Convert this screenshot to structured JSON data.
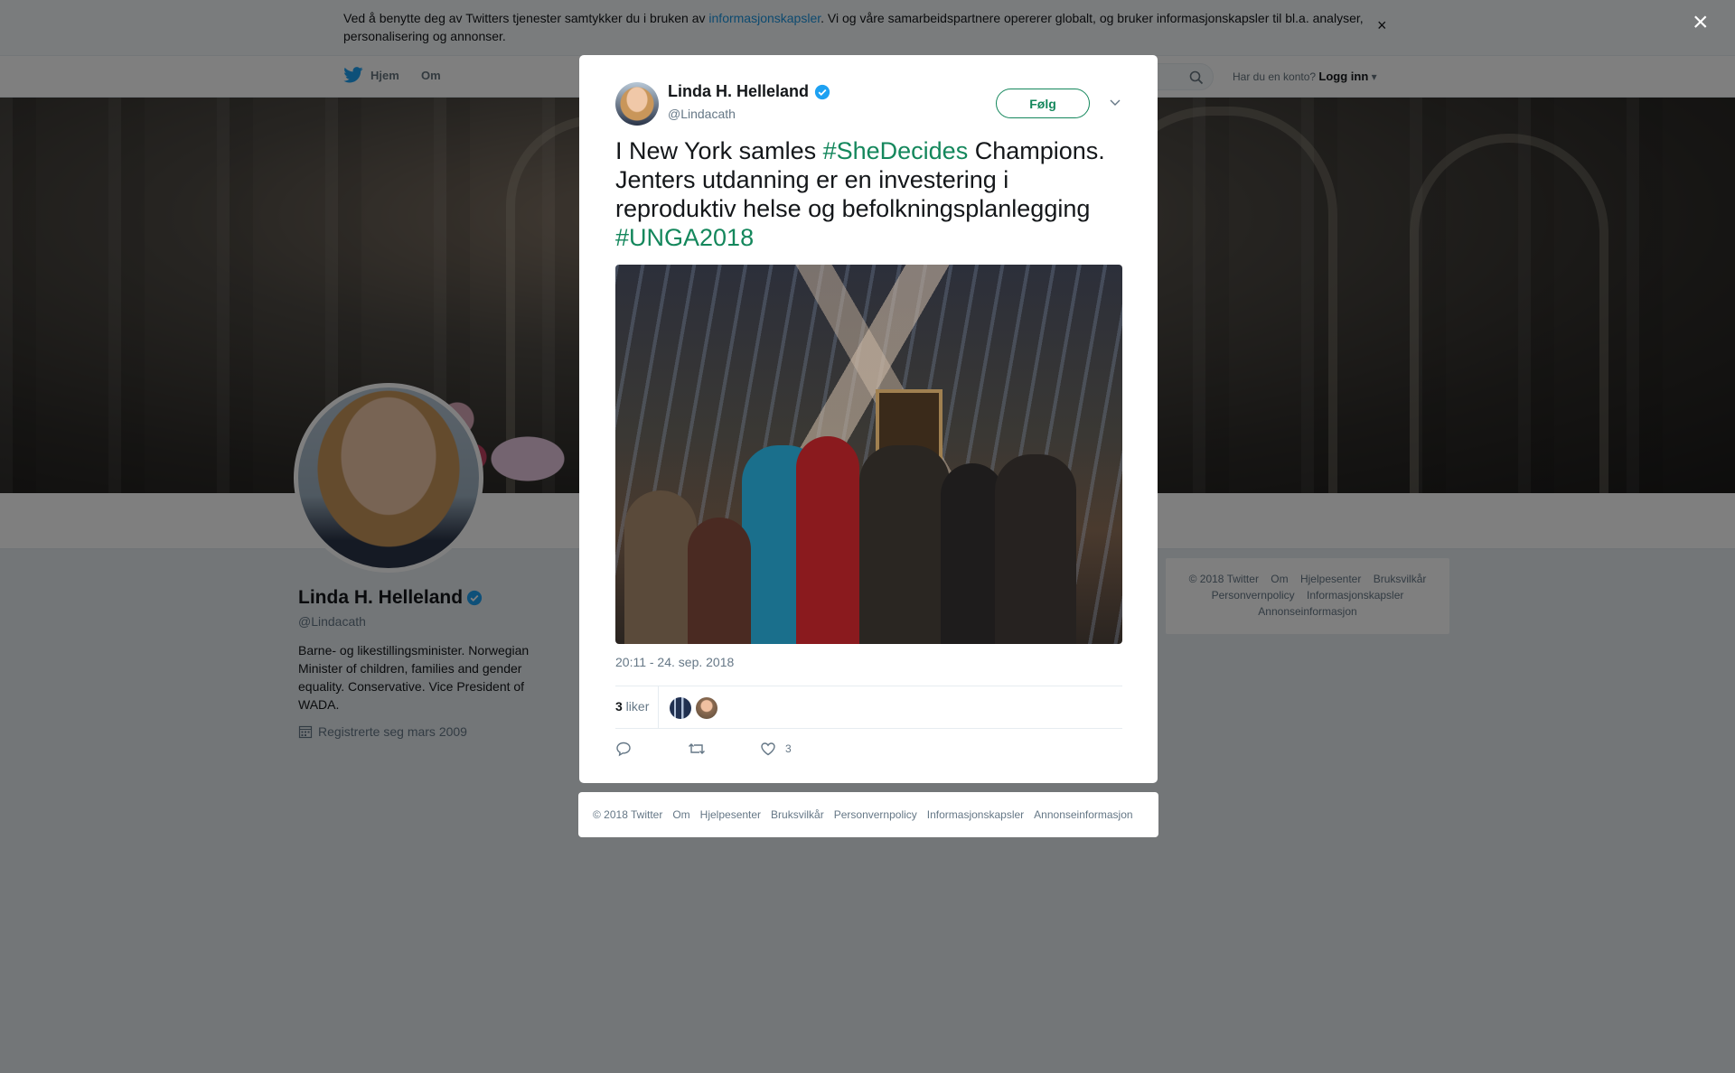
{
  "cookie_bar": {
    "text_before": "Ved å benytte deg av Twitters tjenester samtykker du i bruken av ",
    "link": "informasjonskapsler",
    "text_after": ". Vi og våre samarbeidspartnere opererer globalt, og bruker informasjonskapsler til bl.a. analyser, personalisering og annonser.",
    "close": "×"
  },
  "nav": {
    "home": "Hjem",
    "about": "Om",
    "account_prompt": "Har du en konto?",
    "login": "Logg inn"
  },
  "profile": {
    "name": "Linda H. Helleland",
    "handle": "@Lindacath",
    "bio": "Barne- og likestillingsminister. Norwegian Minister of children, families and gender equality. Conservative. Vice President of WADA.",
    "joined": "Registrerte seg mars 2009"
  },
  "side_footer": {
    "links": [
      "© 2018 Twitter",
      "Om",
      "Hjelpesenter",
      "Bruksvilkår",
      "Personvernpolicy",
      "Informasjonskapsler",
      "Annonseinformasjon"
    ]
  },
  "overlay": {
    "close": "×"
  },
  "tweet": {
    "author_name": "Linda H. Helleland",
    "author_handle": "@Lindacath",
    "follow": "Følg",
    "text_1": "I New York samles ",
    "hashtag_1": "#SheDecides",
    "text_2": " Champions. Jenters utdanning er en investering i reproduktiv helse og befolkningsplanlegging ",
    "hashtag_2": "#UNGA2018",
    "timestamp": "20:11 - 24. sep. 2018",
    "likes_number": "3",
    "likes_label": " liker",
    "like_action_count": "3"
  },
  "modal_footer": {
    "links": [
      "© 2018 Twitter",
      "Om",
      "Hjelpesenter",
      "Bruksvilkår",
      "Personvernpolicy",
      "Informasjonskapsler",
      "Annonseinformasjon"
    ]
  },
  "colors": {
    "accent_green": "#14875c",
    "twitter_blue": "#1da1f2",
    "verified": "#1da1f2",
    "muted": "#657786"
  }
}
